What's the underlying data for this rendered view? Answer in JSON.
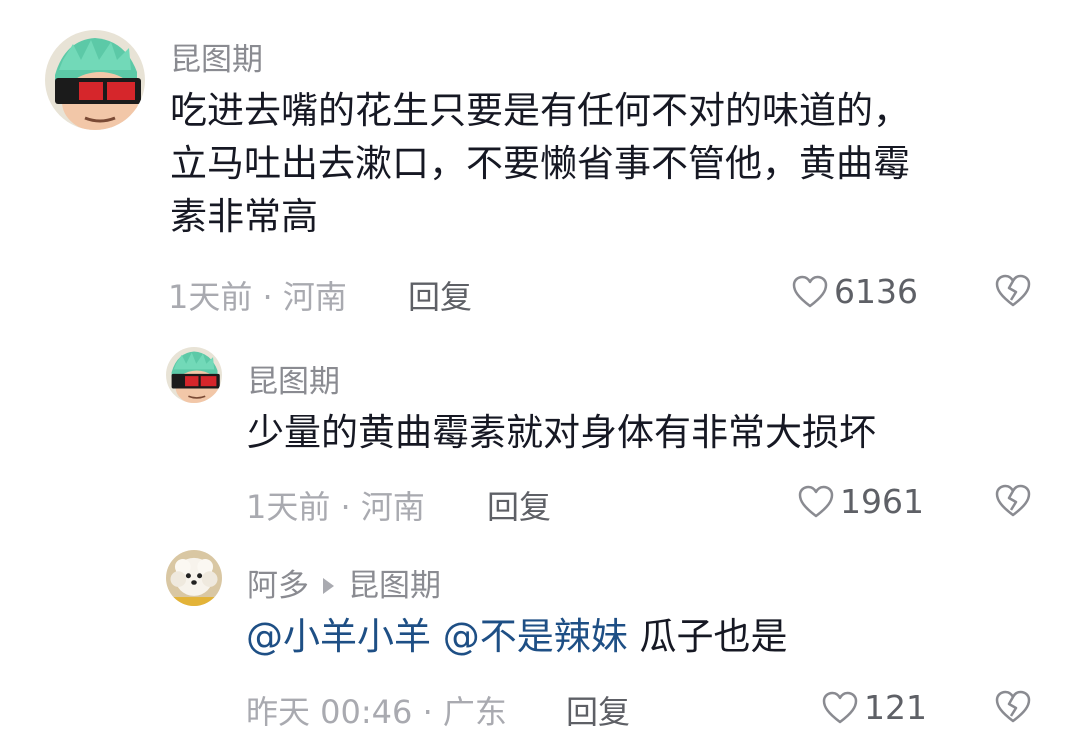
{
  "comments": [
    {
      "username": "昆图期",
      "content_lines": [
        "吃进去嘴的花生只要是有任何不对的味道的，",
        "立马吐出去漱口，不要懒省事不管他，黄曲霉",
        "素非常高"
      ],
      "meta": "1天前 · 河南",
      "reply_label": "回复",
      "likes": "6136"
    },
    {
      "username": "昆图期",
      "content": "少量的黄曲霉素就对身体有非常大损坏",
      "meta": "1天前 · 河南",
      "reply_label": "回复",
      "likes": "1961"
    },
    {
      "username": "阿多",
      "reply_to": "昆图期",
      "mention1": "@小羊小羊",
      "mention2": "@不是辣妹",
      "content_rest": "瓜子也是",
      "meta": "昨天 00:46 · 广东",
      "reply_label": "回复",
      "likes": "121"
    }
  ],
  "icons": {
    "like": "heart-outline-icon",
    "dislike": "broken-heart-icon"
  },
  "colors": {
    "text": "#161823",
    "meta": "#a9aab0",
    "username": "#8a8b91",
    "mention": "#1e4f85"
  }
}
